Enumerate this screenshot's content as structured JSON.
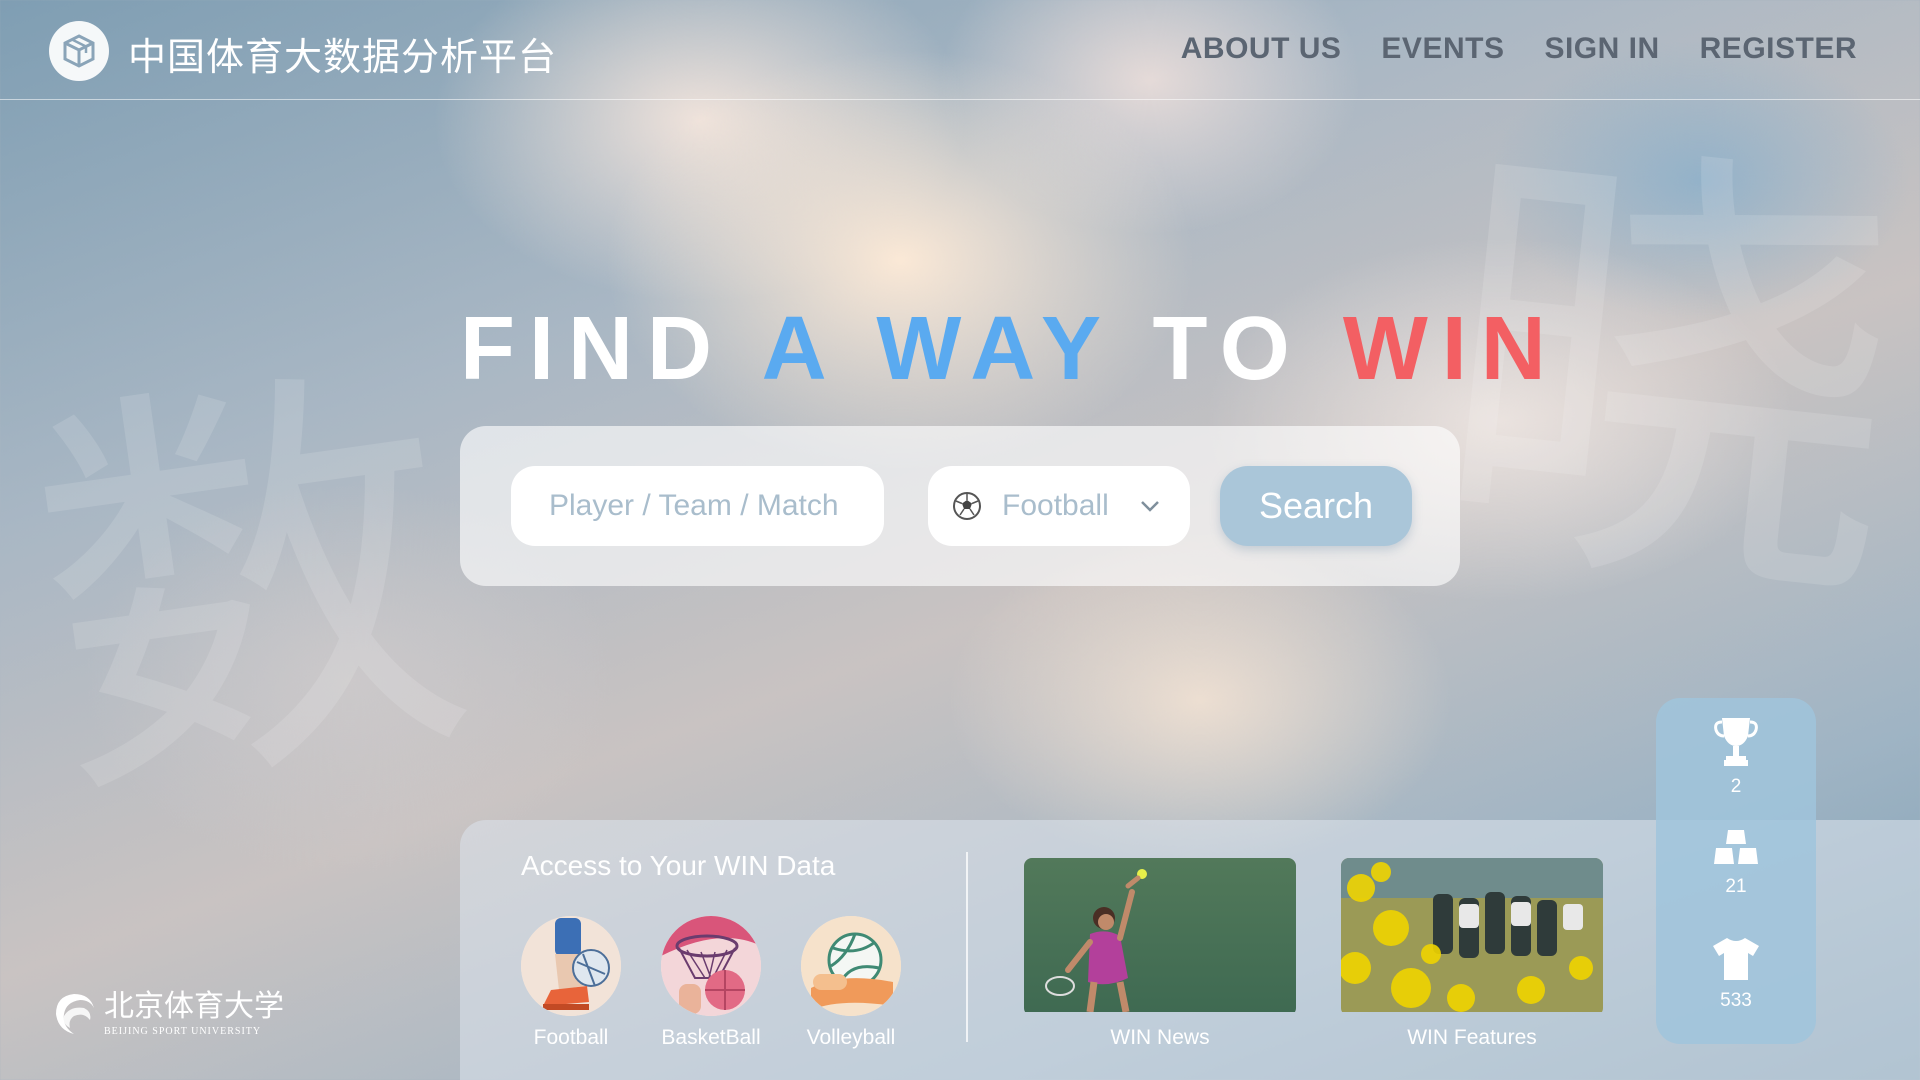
{
  "header": {
    "site_title": "中国体育大数据分析平台",
    "nav": [
      "ABOUT US",
      "EVENTS",
      "SIGN IN",
      "REGISTER"
    ]
  },
  "watermark": {
    "left": "数",
    "right": "晓"
  },
  "hero": {
    "words": [
      "FIND",
      "A WAY",
      "TO",
      "WIN"
    ],
    "colors": {
      "white": "#ffffff",
      "blue": "#5aaaf0",
      "red": "#f35f63"
    }
  },
  "search": {
    "placeholder": "Player / Team / Match",
    "selected_sport": "Football",
    "button_label": "Search"
  },
  "access": {
    "title": "Access to Your WIN Data",
    "sports": [
      {
        "label": "Football",
        "icon": "football-icon"
      },
      {
        "label": "BasketBall",
        "icon": "basketball-icon"
      },
      {
        "label": "Volleyball",
        "icon": "volleyball-icon"
      }
    ],
    "media": [
      {
        "label": "WIN News"
      },
      {
        "label": "WIN Features"
      }
    ]
  },
  "stats": [
    {
      "icon": "trophy-icon",
      "value": "2"
    },
    {
      "icon": "medal-stack-icon",
      "value": "21"
    },
    {
      "icon": "jersey-icon",
      "value": "533"
    }
  ],
  "university": {
    "name_cn": "北京体育大学",
    "name_en": "BEIJING SPORT UNIVERSITY"
  }
}
